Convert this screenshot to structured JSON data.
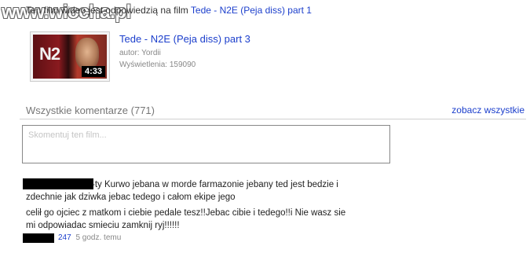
{
  "watermark": {
    "text": "www.wiocha.pl"
  },
  "response": {
    "prefix": "Ten film wideo jest odpowiedzią na film ",
    "link": "Tede - N2E (Peja diss) part 1"
  },
  "video": {
    "title": "Tede - N2E (Peja diss) part 3",
    "author": "autor: Yordii",
    "views": "Wyświetlenia: 159090",
    "duration": "4:33",
    "thumb_text": "N2"
  },
  "comments": {
    "header": "Wszystkie komentarze (771)",
    "see_all": "zobacz wszystkie",
    "input_placeholder": "Skomentuj ten film..."
  },
  "comment": {
    "lines": [
      "-ty Kurwo jebana w morde farmazonie jebany ted jest bedzie i",
      "zdechnie jak dziwka jebac tedego i całom ekipe jego",
      "celił go ojciec z matkom i ciebie pedale tesz!!Jebac cibie i tedego!!i Nie wasz sie",
      "mi odpowiadac smieciu zamknij ryj!!!!!!"
    ],
    "votes": "247",
    "time": "5 godz. temu"
  }
}
